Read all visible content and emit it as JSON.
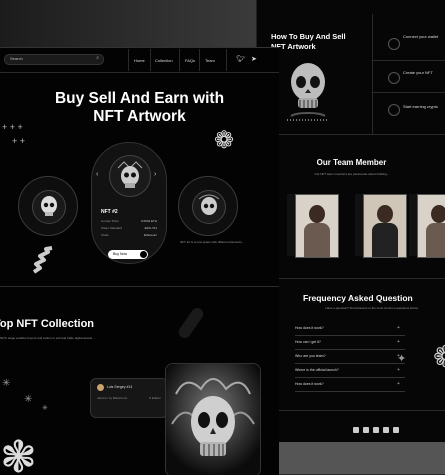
{
  "nav": {
    "search_placeholder": "Search",
    "items": [
      "Home",
      "Collection",
      "FAQs",
      "Team"
    ]
  },
  "hero": {
    "line1": "Buy Sell And Earn with",
    "line2": "NFT Artwork"
  },
  "nft_card": {
    "name": "NFT #2",
    "rows": [
      {
        "label": "Current Price",
        "value": "0.0542 ETH"
      },
      {
        "label": "Token Standard",
        "value": "ERC-721"
      },
      {
        "label": "Chain",
        "value": "Ethereum"
      }
    ],
    "button": "Buy Now"
  },
  "hero_desc": "NFT art is a new space with different elements...",
  "top_collection": {
    "title": "Top NFT Collection",
    "desc": "NFTs stage enables buyers and sellers to sell and trade digital assets..."
  },
  "seller": {
    "name": "Luis Sergey #14",
    "left_meta": "Alpinnor by BlackCrow",
    "right_meta": "8 Edition"
  },
  "howto": {
    "title": "How To Buy And Sell NFT Artwork",
    "steps": [
      "Connect your wallet",
      "Create your NFT",
      "Start earning crypto"
    ]
  },
  "team": {
    "title": "Our Team Member",
    "sub": "Our NFT team members are passionate about building..."
  },
  "faq": {
    "title": "Frequency Asked Question",
    "sub": "Have a question? Find answers to the most common questions below.",
    "questions": [
      "How does it work?",
      "How can i get it?",
      "Who are you team?",
      "Where is the official launch?",
      "How does it work?"
    ]
  },
  "colors": {
    "bg": "#030303",
    "accent": "#ffffff"
  }
}
